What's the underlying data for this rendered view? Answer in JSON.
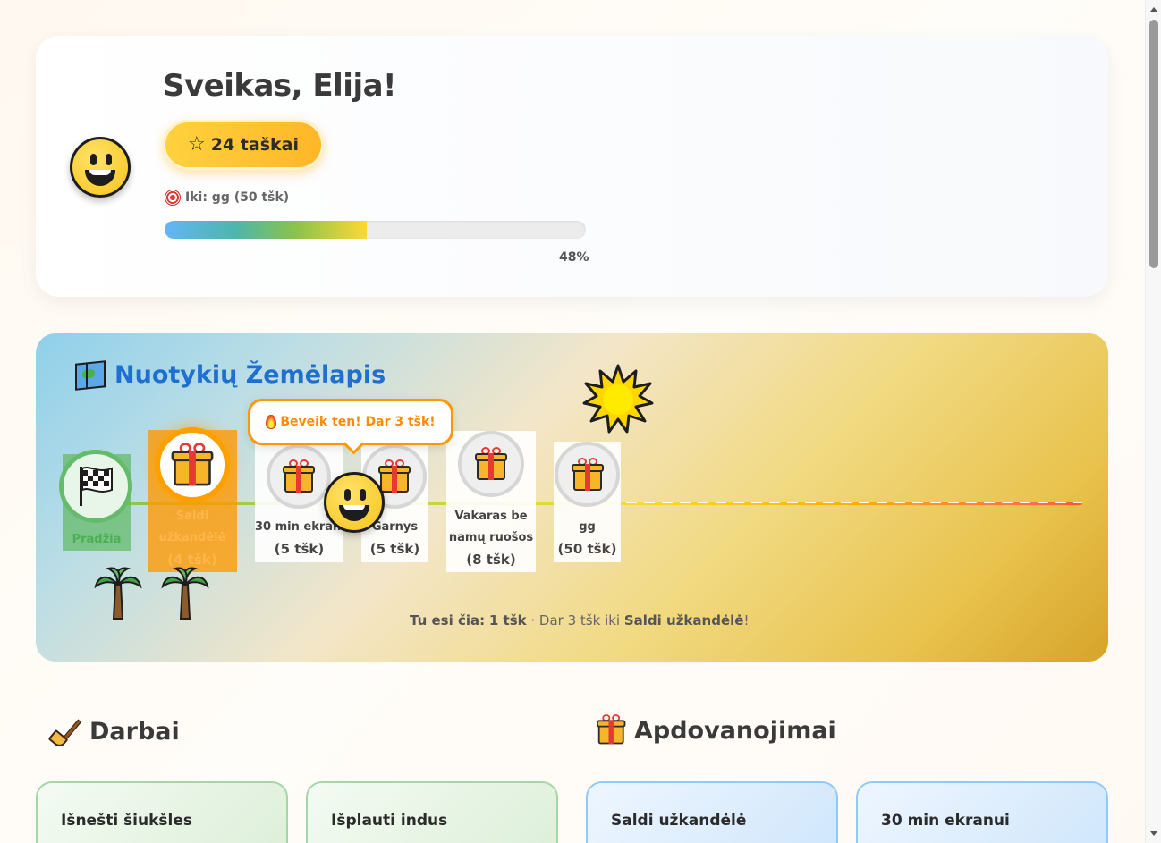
{
  "header": {
    "greeting": "Sveikas, Elija!",
    "points_label": "24 taškai",
    "goal_label": "Iki: gg (50 tšk)",
    "progress_fraction": 0.48,
    "progress_text": "48%"
  },
  "map": {
    "title": "Nuotykių Žemėlapis",
    "start_label": "Pradžia",
    "tooltip": "Beveik ten! Dar 3 tšk!",
    "stops": [
      {
        "label": "Saldi užkandėlė",
        "points": "(4 tšk)"
      },
      {
        "label": "30 min ekranui",
        "points": "(5 tšk)"
      },
      {
        "label": "Garnys",
        "points": "(5 tšk)"
      },
      {
        "label": "Vakaras be namų ruošos",
        "points": "(8 tšk)"
      },
      {
        "label": "gg",
        "points": "(50 tšk)"
      }
    ],
    "status_prefix": "Tu esi čia:",
    "status_points": "1 tšk",
    "status_middle": " · Dar 3 tšk iki ",
    "status_target": "Saldi užkandėlė",
    "status_suffix": "!"
  },
  "sections": {
    "chores_title": "Darbai",
    "rewards_title": "Apdovanojimai"
  },
  "chores": [
    {
      "title": "Išnešti šiukšles"
    },
    {
      "title": "Išplauti indus"
    }
  ],
  "rewards": [
    {
      "title": "Saldi užkandėlė"
    },
    {
      "title": "30 min ekranui"
    }
  ],
  "icons": [
    "smiley-avatar-icon",
    "star-icon",
    "target-icon",
    "map-icon",
    "sun-icon",
    "checkered-flag-icon",
    "gift-icon",
    "fire-icon",
    "palm-tree-icon",
    "broom-icon"
  ]
}
